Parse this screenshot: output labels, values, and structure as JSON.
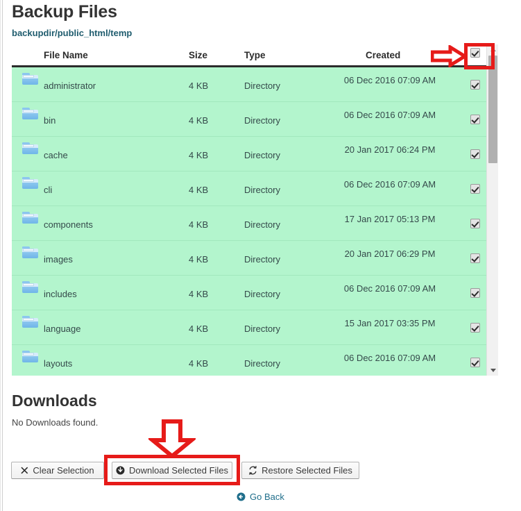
{
  "page": {
    "title": "Backup Files",
    "breadcrumb": "backupdir/public_html/temp"
  },
  "table": {
    "columns": {
      "filename": "File Name",
      "size": "Size",
      "type": "Type",
      "created": "Created"
    },
    "select_all_checked": true,
    "rows": [
      {
        "icon": "folder-icon",
        "name": "administrator",
        "size": "4 KB",
        "type": "Directory",
        "created": "06 Dec 2016 07:09 AM",
        "checked": true
      },
      {
        "icon": "folder-icon",
        "name": "bin",
        "size": "4 KB",
        "type": "Directory",
        "created": "06 Dec 2016 07:09 AM",
        "checked": true
      },
      {
        "icon": "folder-icon",
        "name": "cache",
        "size": "4 KB",
        "type": "Directory",
        "created": "20 Jan 2017 06:24 PM",
        "checked": true
      },
      {
        "icon": "folder-icon",
        "name": "cli",
        "size": "4 KB",
        "type": "Directory",
        "created": "06 Dec 2016 07:09 AM",
        "checked": true
      },
      {
        "icon": "folder-icon",
        "name": "components",
        "size": "4 KB",
        "type": "Directory",
        "created": "17 Jan 2017 05:13 PM",
        "checked": true
      },
      {
        "icon": "folder-icon",
        "name": "images",
        "size": "4 KB",
        "type": "Directory",
        "created": "20 Jan 2017 06:29 PM",
        "checked": true
      },
      {
        "icon": "folder-icon",
        "name": "includes",
        "size": "4 KB",
        "type": "Directory",
        "created": "06 Dec 2016 07:09 AM",
        "checked": true
      },
      {
        "icon": "folder-icon",
        "name": "language",
        "size": "4 KB",
        "type": "Directory",
        "created": "15 Jan 2017 03:35 PM",
        "checked": true
      },
      {
        "icon": "folder-icon",
        "name": "layouts",
        "size": "4 KB",
        "type": "Directory",
        "created": "06 Dec 2016 07:09 AM",
        "checked": true
      }
    ]
  },
  "downloads": {
    "title": "Downloads",
    "empty_message": "No Downloads found."
  },
  "actions": {
    "clear_selection": "Clear Selection",
    "download_selected": "Download Selected Files",
    "restore_selected": "Restore Selected Files",
    "go_back": "Go Back"
  },
  "colors": {
    "row_background": "#b3f5cd",
    "row_border": "#a2e8bd",
    "breadcrumb_text": "#1f5c6e",
    "annotation_red": "#e61b19",
    "link_text": "#1f6e8b",
    "folder_icon": "#8cc6ef"
  }
}
